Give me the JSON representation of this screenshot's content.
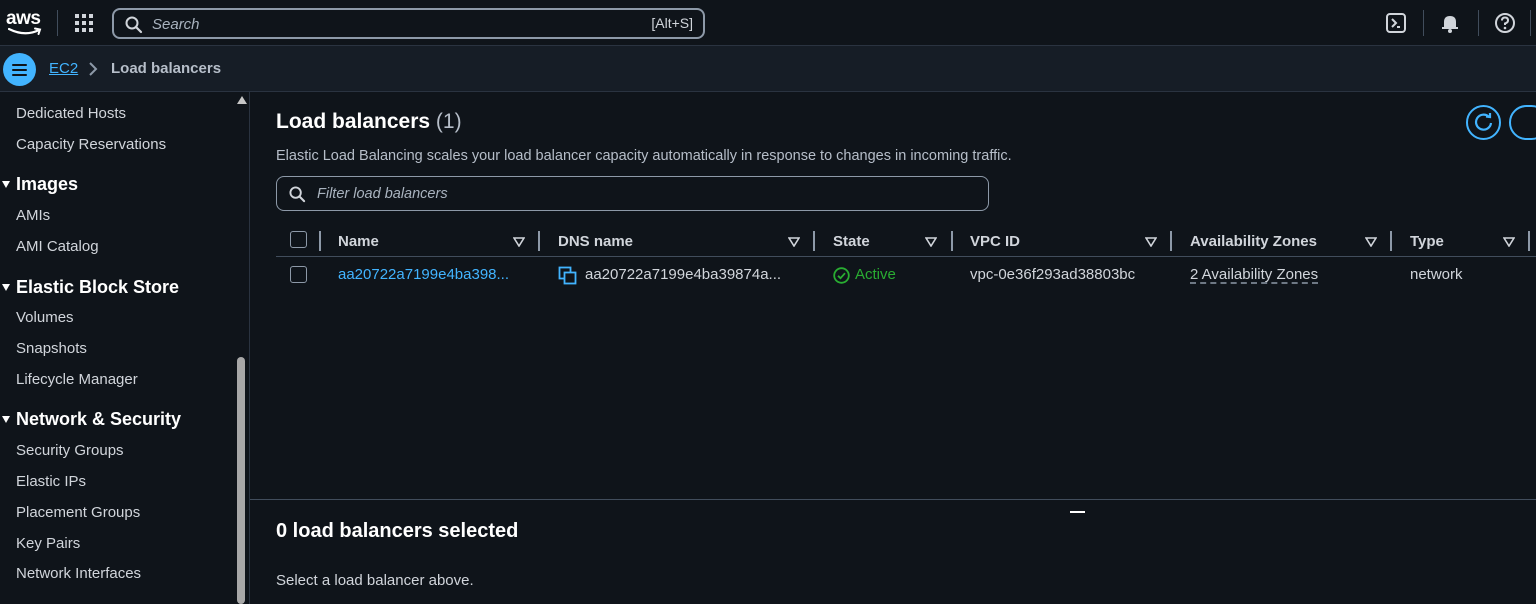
{
  "topbar": {
    "logo_text": "aws",
    "search_placeholder": "Search",
    "search_shortcut": "[Alt+S]",
    "icons": [
      "apps-grid-icon",
      "cloudshell-icon",
      "bell-icon",
      "help-icon"
    ]
  },
  "breadcrumb": {
    "root": "EC2",
    "current": "Load balancers"
  },
  "sidebar": {
    "items_top": [
      "Dedicated Hosts",
      "Capacity Reservations"
    ],
    "images": {
      "heading": "Images",
      "items": [
        "AMIs",
        "AMI Catalog"
      ]
    },
    "ebs": {
      "heading": "Elastic Block Store",
      "items": [
        "Volumes",
        "Snapshots",
        "Lifecycle Manager"
      ]
    },
    "network": {
      "heading": "Network & Security",
      "items": [
        "Security Groups",
        "Elastic IPs",
        "Placement Groups",
        "Key Pairs",
        "Network Interfaces"
      ]
    }
  },
  "main": {
    "title": "Load balancers",
    "count": "(1)",
    "description": "Elastic Load Balancing scales your load balancer capacity automatically in response to changes in incoming traffic.",
    "filter_placeholder": "Filter load balancers",
    "columns": [
      "Name",
      "DNS name",
      "State",
      "VPC ID",
      "Availability Zones",
      "Type"
    ],
    "rows": [
      {
        "name": "aa20722a7199e4ba398...",
        "dns": "aa20722a7199e4ba39874a...",
        "state": "Active",
        "vpc": "vpc-0e36f293ad38803bc",
        "zones": "2 Availability Zones",
        "type": "network"
      }
    ]
  },
  "bottom": {
    "title": "0 load balancers selected",
    "message": "Select a load balancer above."
  },
  "colors": {
    "accent": "#42b4ff",
    "success": "#29ad32",
    "background": "#0f141a"
  }
}
